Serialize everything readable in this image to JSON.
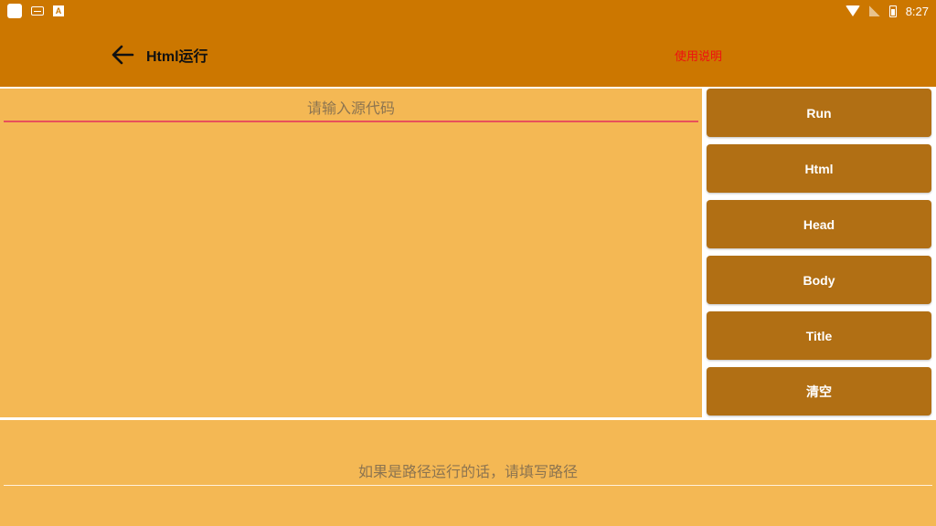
{
  "status_bar": {
    "time": "8:27",
    "left_icons": [
      "app-square-icon",
      "keyboard-icon",
      "a-letter-icon"
    ],
    "right_icons": [
      "wifi-icon",
      "no-signal-icon",
      "battery-charging-icon"
    ],
    "a_icon_letter": "A"
  },
  "app_bar": {
    "title": "Html运行",
    "help_label": "使用说明",
    "help_color": "#ee1111",
    "background": "#cc7700"
  },
  "editor": {
    "source_placeholder": "请输入源代码",
    "source_value": "",
    "path_placeholder": "如果是路径运行的话，请填写路径",
    "path_value": "",
    "panel_color": "#f4b854"
  },
  "buttons": {
    "color": "#b16f14",
    "run": "Run",
    "html": "Html",
    "head": "Head",
    "body": "Body",
    "title": "Title",
    "clear": "清空"
  }
}
